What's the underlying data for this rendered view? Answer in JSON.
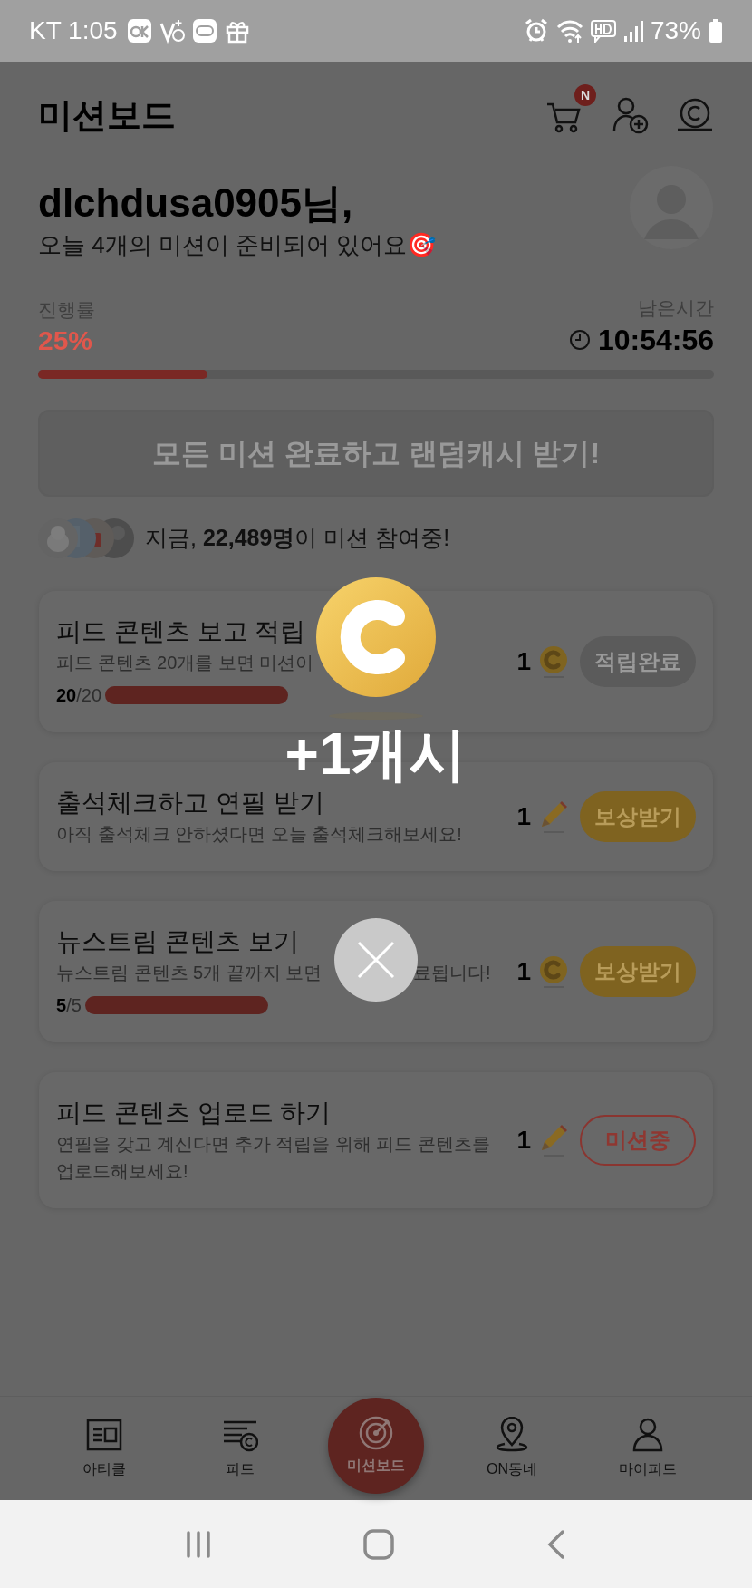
{
  "status_bar": {
    "carrier_time": "KT 1:05",
    "battery": "73%"
  },
  "header": {
    "title": "미션보드",
    "cart_badge": "N"
  },
  "profile": {
    "greeting": "dlchdusa0905님,",
    "subtitle": "오늘 4개의 미션이 준비되어 있어요🎯"
  },
  "progress": {
    "label": "진행률",
    "value": "25%",
    "level": 0.25,
    "time_label": "남은시간",
    "time": "10:54:56"
  },
  "all_missions_button": "모든 미션 완료하고 랜덤캐시 받기!",
  "participants": {
    "text": "지금, **22,489명**이 미션 참여중!"
  },
  "missions": [
    {
      "title": "피드 콘텐츠 보고 적립",
      "desc": [
        "피드 콘텐츠 20개를 보면 미션이"
      ],
      "count": "20",
      "total": "/20",
      "reward": {
        "amount": "1",
        "kind": "coin"
      },
      "status": {
        "label": "적립완료",
        "kind": "done"
      }
    },
    {
      "title": "출석체크하고 연필 받기",
      "desc": [
        "아직 출석체크 안하셨다면 오늘 출석체크해보세요!"
      ],
      "reward": {
        "amount": "1",
        "kind": "pencil"
      },
      "status": {
        "label": "보상받기",
        "kind": "claim"
      }
    },
    {
      "title": "뉴스트림 콘텐츠 보기",
      "desc": [
        "뉴스트림 콘텐츠 5개 끝까지 보면",
        "료됩니다!"
      ],
      "count": "5",
      "total": "/5",
      "reward": {
        "amount": "1",
        "kind": "coin"
      },
      "status": {
        "label": "보상받기",
        "kind": "claim"
      }
    },
    {
      "title": "피드 콘텐츠 업로드 하기",
      "desc": [
        "연필을 갖고 계신다면 추가 적립을 위해 피드 콘텐츠를 업로드해보세요!"
      ],
      "reward": {
        "amount": "1",
        "kind": "pencil"
      },
      "status": {
        "label": "미션중",
        "kind": "ongoing"
      }
    }
  ],
  "bottom_nav": [
    {
      "label": "아티클",
      "selected": false
    },
    {
      "label": "피드",
      "selected": false
    },
    {
      "label": "미션보드",
      "selected": true
    },
    {
      "label": "ON동네",
      "selected": false
    },
    {
      "label": "마이피드",
      "selected": false
    }
  ],
  "popup": {
    "reward": "+1캐시"
  }
}
